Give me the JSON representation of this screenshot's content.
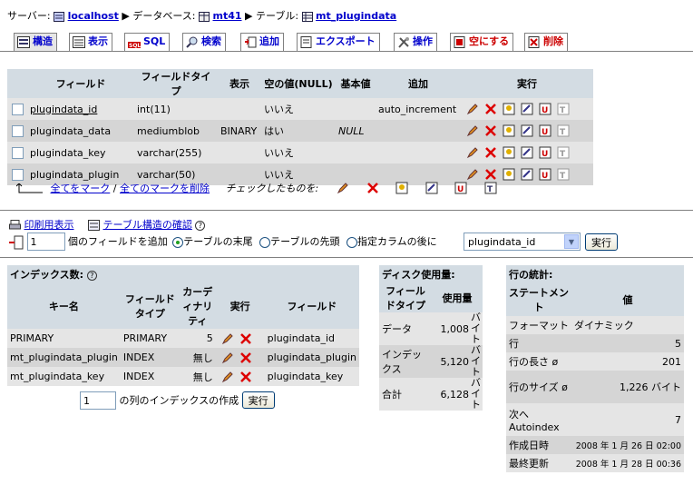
{
  "breadcrumb": {
    "server_label": "サーバー:",
    "server": "localhost",
    "db_label": "データベース:",
    "db": "mt41",
    "table_label": "テーブル:",
    "table": "mt_plugindata"
  },
  "tabs": [
    {
      "label": "構造",
      "icon": "structure-icon"
    },
    {
      "label": "表示",
      "icon": "browse-icon"
    },
    {
      "label": "SQL",
      "icon": "sql-icon"
    },
    {
      "label": "検索",
      "icon": "search-icon"
    },
    {
      "label": "追加",
      "icon": "insert-icon"
    },
    {
      "label": "エクスポート",
      "icon": "export-icon"
    },
    {
      "label": "操作",
      "icon": "operations-icon"
    },
    {
      "label": "空にする",
      "icon": "empty-icon"
    },
    {
      "label": "削除",
      "icon": "drop-icon"
    }
  ],
  "fields_table": {
    "headers": [
      "フィールド",
      "フィールドタイプ",
      "表示",
      "空の値(NULL)",
      "基本値",
      "追加",
      "実行"
    ],
    "rows": [
      {
        "name": "plugindata_id",
        "type": "int(11)",
        "attr": "",
        "null": "いいえ",
        "default": "",
        "extra": "auto_increment"
      },
      {
        "name": "plugindata_data",
        "type": "mediumblob",
        "attr": "BINARY",
        "null": "はい",
        "default": "NULL",
        "extra": ""
      },
      {
        "name": "plugindata_key",
        "type": "varchar(255)",
        "attr": "",
        "null": "いいえ",
        "default": "",
        "extra": ""
      },
      {
        "name": "plugindata_plugin",
        "type": "varchar(50)",
        "attr": "",
        "null": "いいえ",
        "default": "",
        "extra": ""
      }
    ],
    "check_all": "全てをマーク",
    "sep": "/",
    "uncheck_all": "全てのマークを削除",
    "with_selected": "チェックしたものを:"
  },
  "links": {
    "print": "印刷用表示",
    "propose": "テーブル構造の確認"
  },
  "add_fields": {
    "count": "1",
    "label": "個のフィールドを追加",
    "opt_end": "テーブルの末尾",
    "opt_begin": "テーブルの先頭",
    "opt_after": "指定カラムの後に",
    "after_field": "plugindata_id",
    "go": "実行"
  },
  "indexes": {
    "title": "インデックス数:",
    "headers": [
      "キー名",
      "フィールドタイプ",
      "カーディナリティ",
      "実行",
      "フィールド"
    ],
    "rows": [
      {
        "key": "PRIMARY",
        "type": "PRIMARY",
        "card": "5",
        "field": "plugindata_id"
      },
      {
        "key": "mt_plugindata_plugin",
        "type": "INDEX",
        "card": "無し",
        "field": "plugindata_plugin"
      },
      {
        "key": "mt_plugindata_key",
        "type": "INDEX",
        "card": "無し",
        "field": "plugindata_key"
      }
    ],
    "create_count": "1",
    "create_label": "の列のインデックスの作成",
    "go": "実行"
  },
  "disk": {
    "title": "ディスク使用量:",
    "headers": [
      "フィールドタイプ",
      "使用量"
    ],
    "rows": [
      {
        "type": "データ",
        "size": "1,008",
        "unit": "バイト"
      },
      {
        "type": "インデックス",
        "size": "5,120",
        "unit": "バイト"
      },
      {
        "type": "合計",
        "size": "6,128",
        "unit": "バイト"
      }
    ]
  },
  "rowstats": {
    "title": "行の統計:",
    "headers": [
      "ステートメント",
      "値"
    ],
    "rows": [
      {
        "stmt": "フォーマット",
        "val": "ダイナミック"
      },
      {
        "stmt": "行",
        "val": "5"
      },
      {
        "stmt": "行の長さ ø",
        "val": "201"
      },
      {
        "stmt": "行のサイズ ø",
        "val": "1,226 バイト"
      },
      {
        "stmt": "次へ Autoindex",
        "val": "7"
      },
      {
        "stmt": "作成日時",
        "val": "2008 年 1 月 26 日 02:00"
      },
      {
        "stmt": "最終更新",
        "val": "2008 年 1 月 28 日 00:36"
      }
    ]
  }
}
